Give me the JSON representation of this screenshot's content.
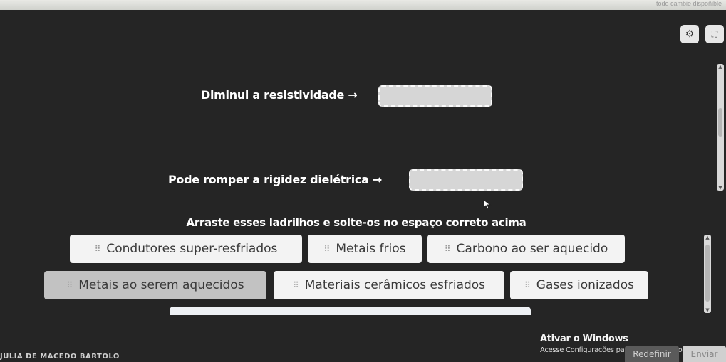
{
  "topbar": {
    "faded_text": "todo cambie dispoñible"
  },
  "toolbar": {
    "settings_icon": "⚙",
    "fullscreen_icon": "⛶"
  },
  "prompts": [
    {
      "label": "Diminui a resistividade →"
    },
    {
      "label": "Pode romper a rigidez dielétrica →"
    }
  ],
  "instruction": "Arraste esses ladrilhos e solte-os no espaço correto acima",
  "tiles": [
    {
      "label": "Condutores super-resfriados",
      "grip": "⠿"
    },
    {
      "label": "Metais frios",
      "grip": "⠿"
    },
    {
      "label": "Carbono ao ser aquecido",
      "grip": "⠿"
    },
    {
      "label": "Metais ao serem aquecidos",
      "grip": "⠿"
    },
    {
      "label": "Materiais cerâmicos esfriados",
      "grip": "⠿"
    },
    {
      "label": "Gases ionizados",
      "grip": "⠿"
    }
  ],
  "watermark": {
    "title": "Ativar o Windows",
    "subtitle": "Acesse Configurações para ativar o Windows."
  },
  "footer": {
    "reset_label": "Redefinir",
    "submit_label": "Enviar",
    "student_name": "JULIA DE MACEDO BARTOLO"
  },
  "colors": {
    "background": "#232323",
    "tile": "#f3f3f3",
    "tile_active": "#c2c2c2",
    "dropzone": "#d6d6d6"
  }
}
